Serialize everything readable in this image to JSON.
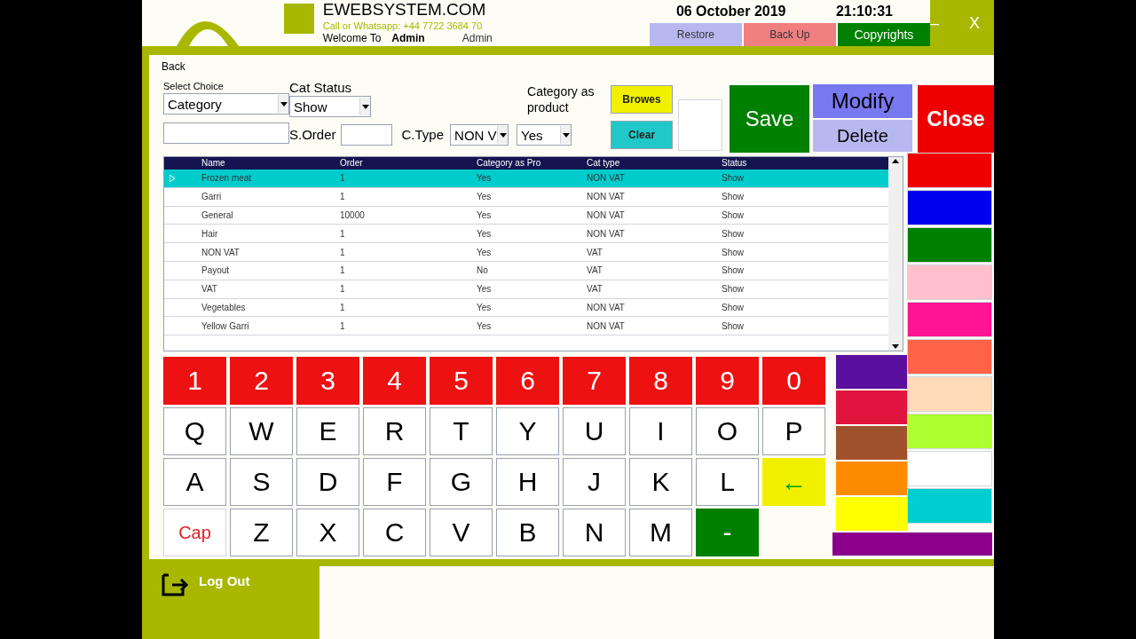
{
  "header": {
    "site": "EWEBSYSTEM.COM",
    "contact": "Call or Whatsapp: +44 7722 3684 70",
    "welcome": "Welcome To",
    "user": "Admin",
    "role": "Admin",
    "date": "06 October 2019",
    "time": "21:10:31",
    "buttons": [
      {
        "label": "Restore",
        "kind": "restore"
      },
      {
        "label": "Back Up",
        "kind": "backup"
      },
      {
        "label": "Copyrights",
        "kind": "copyrights"
      }
    ],
    "minimize": "–",
    "close": "X"
  },
  "back": "Back",
  "form": {
    "select_choice_label": "Select Choice",
    "select_choice": "Category",
    "cat_status_label": "Cat Status",
    "cat_status": "Show",
    "s_order_label": "S.Order",
    "c_type_label": "C.Type",
    "c_type": "NON V",
    "cap_label": "Category as product",
    "cap_value": "Yes"
  },
  "actions": [
    {
      "label": "Browes",
      "kind": "browse"
    },
    {
      "label": "Clear",
      "kind": "clear"
    },
    {
      "label": "Save",
      "kind": "save"
    },
    {
      "label": "Modify",
      "kind": "modify"
    },
    {
      "label": "Delete",
      "kind": "delete"
    },
    {
      "label": "Close",
      "kind": "close"
    }
  ],
  "table": {
    "columns": [
      "Name",
      "Order",
      "Category as Pro",
      "Cat type",
      "Status"
    ],
    "rows": [
      {
        "cells": [
          "Frozen meat",
          "1",
          "Yes",
          "NON VAT",
          "Show"
        ],
        "selected": true
      },
      {
        "cells": [
          "Garri",
          "1",
          "Yes",
          "NON VAT",
          "Show"
        ],
        "selected": false
      },
      {
        "cells": [
          "General",
          "10000",
          "Yes",
          "NON VAT",
          "Show"
        ],
        "selected": false
      },
      {
        "cells": [
          "Hair",
          "1",
          "Yes",
          "NON VAT",
          "Show"
        ],
        "selected": false
      },
      {
        "cells": [
          "NON VAT",
          "1",
          "Yes",
          "VAT",
          "Show"
        ],
        "selected": false
      },
      {
        "cells": [
          "Payout",
          "1",
          "No",
          "VAT",
          "Show"
        ],
        "selected": false
      },
      {
        "cells": [
          "VAT",
          "1",
          "Yes",
          "VAT",
          "Show"
        ],
        "selected": false
      },
      {
        "cells": [
          "Vegetables",
          "1",
          "Yes",
          "NON VAT",
          "Show"
        ],
        "selected": false
      },
      {
        "cells": [
          "Yellow Garri",
          "1",
          "Yes",
          "NON VAT",
          "Show"
        ],
        "selected": false
      }
    ]
  },
  "keyboard": [
    [
      {
        "label": "1",
        "kind": "number"
      },
      {
        "label": "2",
        "kind": "number"
      },
      {
        "label": "3",
        "kind": "number"
      },
      {
        "label": "4",
        "kind": "number"
      },
      {
        "label": "5",
        "kind": "number"
      },
      {
        "label": "6",
        "kind": "number"
      },
      {
        "label": "7",
        "kind": "number"
      },
      {
        "label": "8",
        "kind": "number"
      },
      {
        "label": "9",
        "kind": "number"
      },
      {
        "label": "0",
        "kind": "number"
      }
    ],
    [
      {
        "label": "Q",
        "kind": "letter"
      },
      {
        "label": "W",
        "kind": "letter"
      },
      {
        "label": "E",
        "kind": "letter"
      },
      {
        "label": "R",
        "kind": "letter"
      },
      {
        "label": "T",
        "kind": "letter"
      },
      {
        "label": "Y",
        "kind": "letter"
      },
      {
        "label": "U",
        "kind": "letter"
      },
      {
        "label": "I",
        "kind": "letter"
      },
      {
        "label": "O",
        "kind": "letter"
      },
      {
        "label": "P",
        "kind": "letter"
      }
    ],
    [
      {
        "label": "A",
        "kind": "letter"
      },
      {
        "label": "S",
        "kind": "letter"
      },
      {
        "label": "D",
        "kind": "letter"
      },
      {
        "label": "F",
        "kind": "letter"
      },
      {
        "label": "G",
        "kind": "letter"
      },
      {
        "label": "H",
        "kind": "letter"
      },
      {
        "label": "J",
        "kind": "letter"
      },
      {
        "label": "K",
        "kind": "letter"
      },
      {
        "label": "L",
        "kind": "letter"
      },
      {
        "label": "←",
        "kind": "backspace"
      }
    ],
    [
      {
        "label": "Cap",
        "kind": "cap"
      },
      {
        "label": "Z",
        "kind": "letter"
      },
      {
        "label": "X",
        "kind": "letter"
      },
      {
        "label": "C",
        "kind": "letter"
      },
      {
        "label": "V",
        "kind": "letter"
      },
      {
        "label": "B",
        "kind": "letter"
      },
      {
        "label": "N",
        "kind": "letter"
      },
      {
        "label": "M",
        "kind": "letter"
      },
      {
        "label": "-",
        "kind": "dash"
      }
    ]
  ],
  "palette_left": [
    {
      "color": "#5b0f9e"
    },
    {
      "color": "#e0143c"
    },
    {
      "color": "#a0522d"
    },
    {
      "color": "#ff8c00"
    },
    {
      "color": "#ffff00"
    }
  ],
  "palette_right": [
    {
      "color": "#ee0000"
    },
    {
      "color": "#0000ee"
    },
    {
      "color": "#008000"
    },
    {
      "color": "#ffc0cb"
    },
    {
      "color": "#ff1493"
    },
    {
      "color": "#ff6347"
    },
    {
      "color": "#ffdab9"
    },
    {
      "color": "#adff2f"
    },
    {
      "color": "#ffffff"
    },
    {
      "color": "#00ced1"
    }
  ],
  "palette_bottom": {
    "color": "#8b008b"
  },
  "logout": "Log Out"
}
